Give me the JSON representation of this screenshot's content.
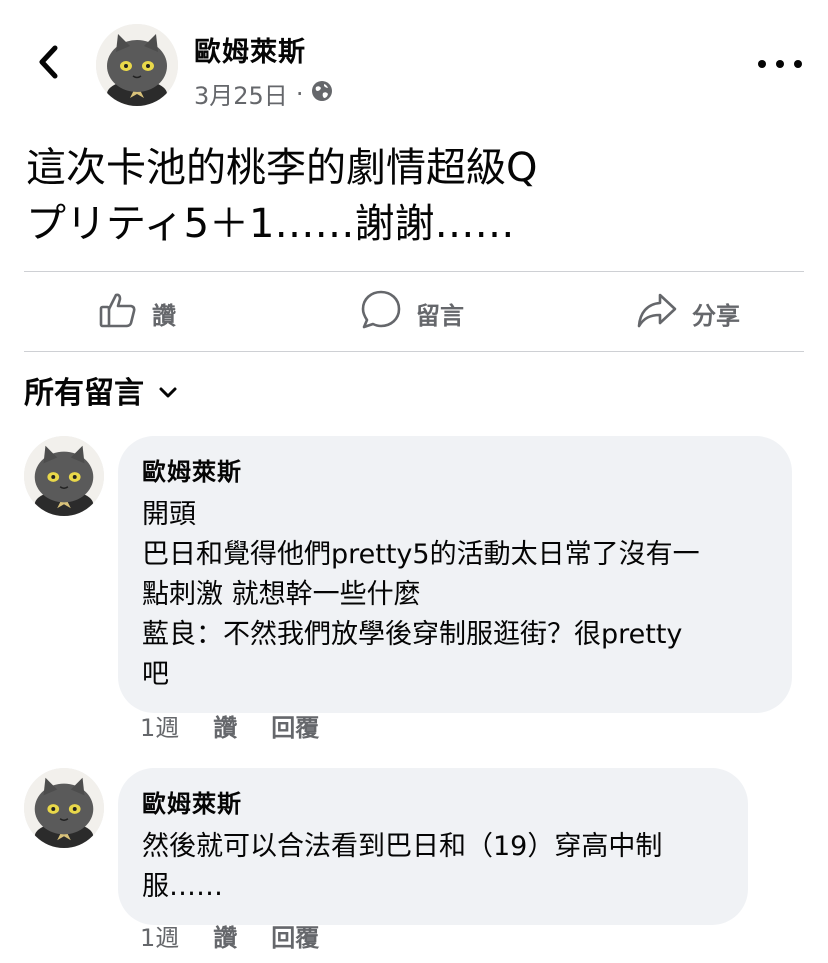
{
  "header": {
    "back_icon": "chevron-left-icon",
    "author": "歐姆萊斯",
    "date": "3月25日",
    "separator": "·",
    "privacy_icon": "globe-icon",
    "more_icon": "more-horizontal-icon"
  },
  "post": {
    "text_lines": [
      "這次卡池的桃李的劇情超級Q",
      "プリティ5＋1……謝謝……"
    ]
  },
  "actions": {
    "like": {
      "label": "讚",
      "icon": "thumbs-up-icon"
    },
    "comment": {
      "label": "留言",
      "icon": "comment-bubble-icon"
    },
    "share": {
      "label": "分享",
      "icon": "share-arrow-icon"
    }
  },
  "comments_header": {
    "label": "所有留言",
    "icon": "chevron-down-icon"
  },
  "comments": [
    {
      "author": "歐姆萊斯",
      "lines": [
        "開頭",
        "巴日和覺得他們pretty5的活動太日常了沒有一",
        "點刺激 就想幹一些什麼",
        "藍良：不然我們放學後穿制服逛街？很pretty",
        "吧"
      ],
      "time": "1週",
      "like_label": "讚",
      "reply_label": "回覆"
    },
    {
      "author": "歐姆萊斯",
      "lines": [
        "然後就可以合法看到巴日和（19）穿高中制",
        "服……"
      ],
      "time": "1週",
      "like_label": "讚",
      "reply_label": "回覆"
    }
  ],
  "colors": {
    "text": "#050505",
    "secondary": "#65676b",
    "bubble": "#f0f2f5",
    "divider": "#ced0d4"
  }
}
